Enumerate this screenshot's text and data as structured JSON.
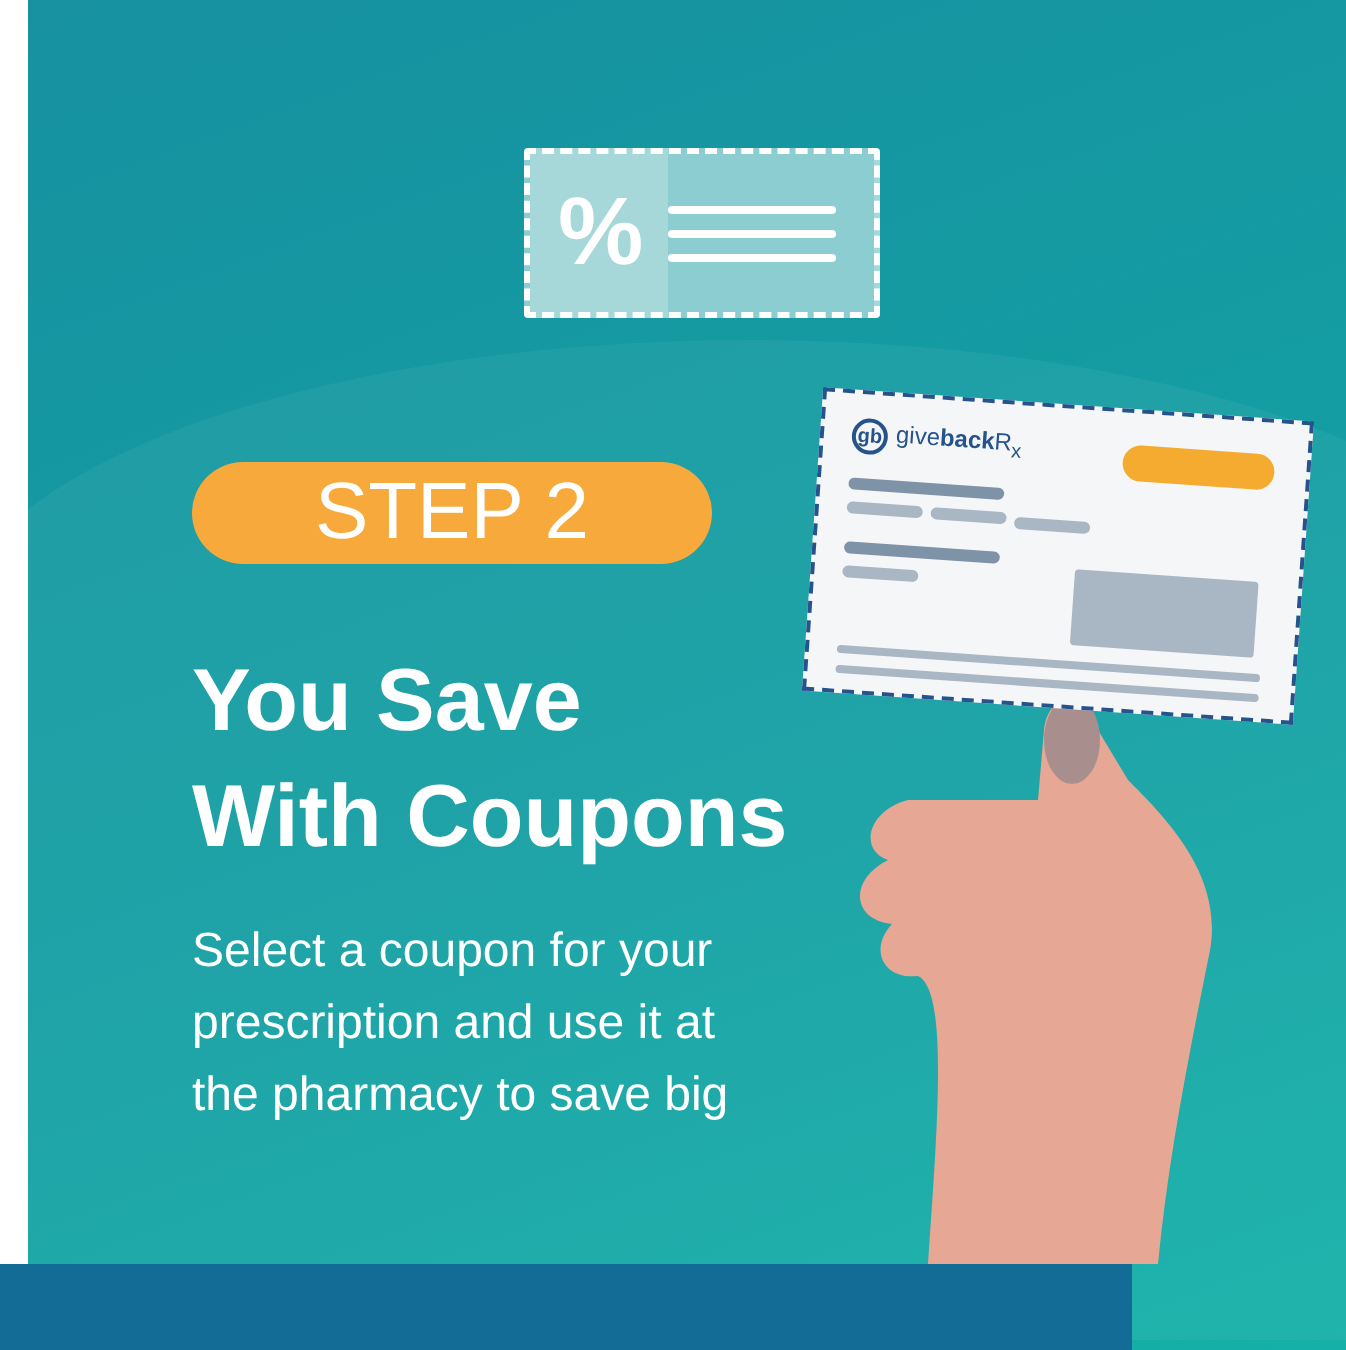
{
  "banner": {
    "coupon_icon_symbol": "%",
    "step_label": "STEP 2",
    "title_lines": [
      "You Save",
      "With Coupons"
    ],
    "description": "Select a coupon for your prescription and use it at the pharmacy to save big",
    "card": {
      "logo_mark": "gb",
      "logo_text": "give**back**R$_{x}$"
    }
  }
}
